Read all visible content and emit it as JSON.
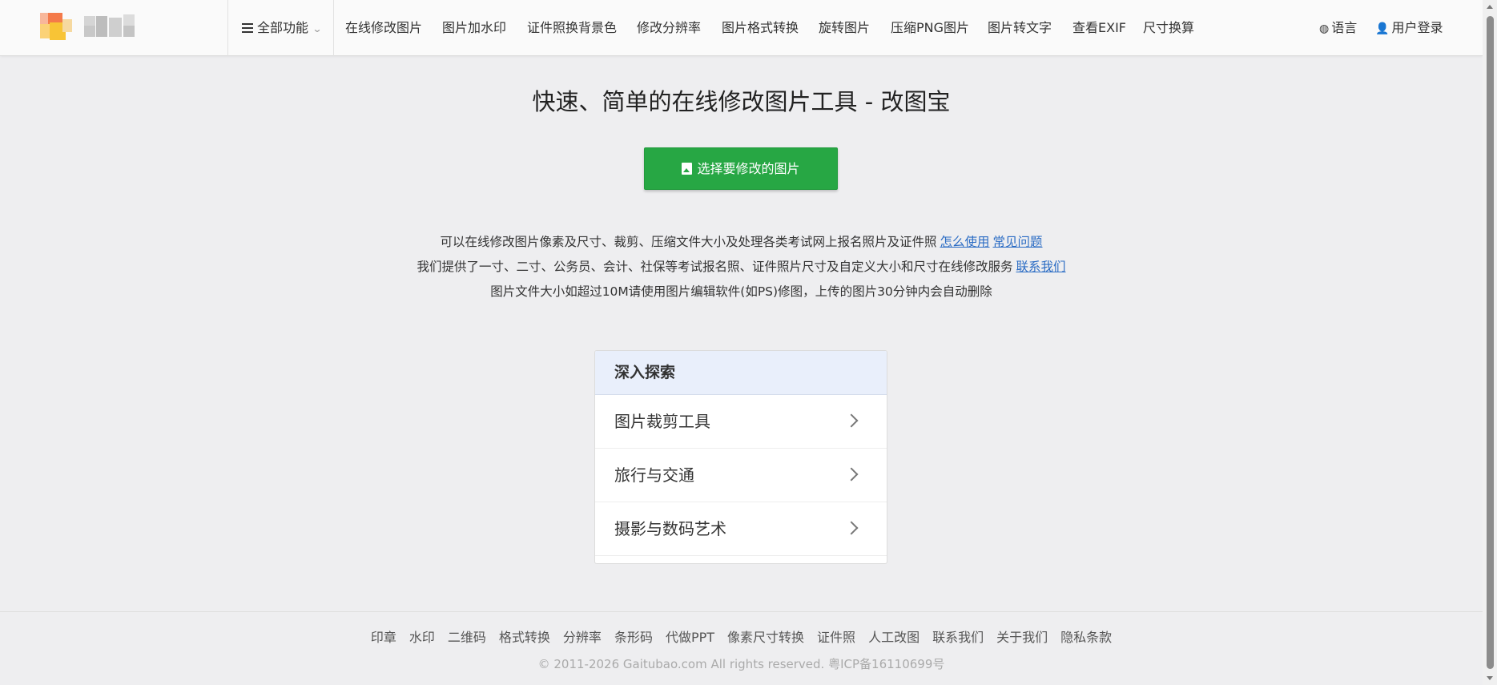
{
  "header": {
    "all_functions": "全部功能",
    "nav": [
      "在线修改图片",
      "图片加水印",
      "证件照换背景色",
      "修改分辨率",
      "图片格式转换",
      "旋转图片",
      "压缩PNG图片",
      "图片转文字",
      "查看EXIF",
      "尺寸换算"
    ],
    "language": "语言",
    "login": "用户登录"
  },
  "main": {
    "title": "快速、简单的在线修改图片工具 - 改图宝",
    "select_button": "选择要修改的图片",
    "desc_line1": "可以在线修改图片像素及尺寸、裁剪、压缩文件大小及处理各类考试网上报名照片及证件照",
    "link_how": "怎么使用",
    "link_faq": "常见问题",
    "desc_line2": "我们提供了一寸、二寸、公务员、会计、社保等考试报名照、证件照片尺寸及自定义大小和尺寸在线修改服务",
    "link_contact": "联系我们",
    "desc_line3": "图片文件大小如超过10M请使用图片编辑软件(如PS)修图，上传的图片30分钟内会自动删除"
  },
  "explore": {
    "title": "深入探索",
    "items": [
      "图片裁剪工具",
      "旅行与交通",
      "摄影与数码艺术"
    ]
  },
  "footer": {
    "links": [
      "印章",
      "水印",
      "二维码",
      "格式转换",
      "分辨率",
      "条形码",
      "代做PPT",
      "像素尺寸转换",
      "证件照",
      "人工改图",
      "联系我们",
      "关于我们",
      "隐私条款"
    ],
    "copyright": "© 2011-2026 Gaitubao.com All rights reserved. 粤ICP备16110699号"
  },
  "colors": {
    "primary_button": "#27a744",
    "link": "#2b6cc4",
    "panel_header_bg": "#e9effb",
    "page_bg": "#eeeef0"
  }
}
